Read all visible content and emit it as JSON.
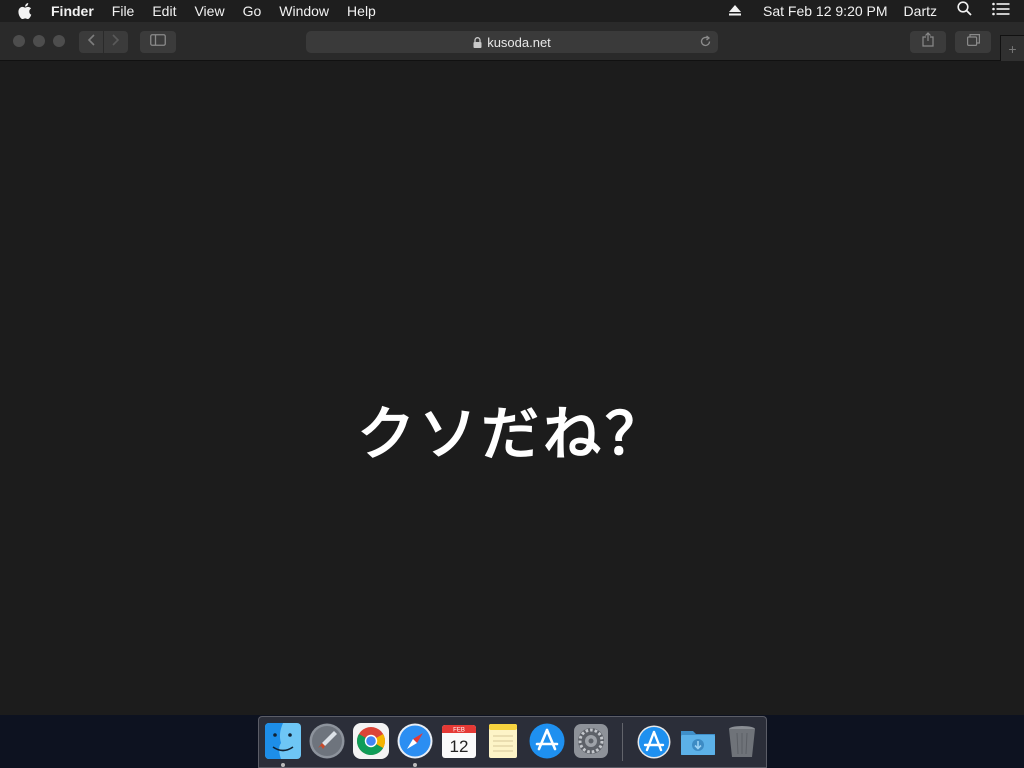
{
  "menubar": {
    "app_name": "Finder",
    "menus": [
      "File",
      "Edit",
      "View",
      "Go",
      "Window",
      "Help"
    ],
    "datetime": "Sat Feb 12  9:20 PM",
    "user": "Dartz",
    "icons": [
      "apple-icon",
      "eject-icon",
      "spotlight-search-icon",
      "notification-center-icon"
    ]
  },
  "browser": {
    "url": "kusoda.net",
    "secure": true,
    "toolbar_icons": [
      "back-icon",
      "forward-icon",
      "sidebar-icon",
      "share-icon",
      "tabs-overview-icon",
      "new-tab-icon"
    ]
  },
  "page": {
    "headline": "クソだね？"
  },
  "dock": {
    "apps": [
      "Finder",
      "Launchpad",
      "Google Chrome",
      "Safari",
      "Calendar",
      "Notes",
      "App Store",
      "System Preferences",
      "App Store Downloads",
      "Downloads",
      "Trash"
    ],
    "calendar": {
      "month": "FEB",
      "day": "12"
    },
    "running": [
      "Finder",
      "Safari"
    ]
  },
  "colors": {
    "menubar_bg": "#1e1e1e",
    "window_bg": "#1c1c1c",
    "toolbar_bg": "#2a2a2a",
    "desktop_bg": "#0d1220"
  }
}
